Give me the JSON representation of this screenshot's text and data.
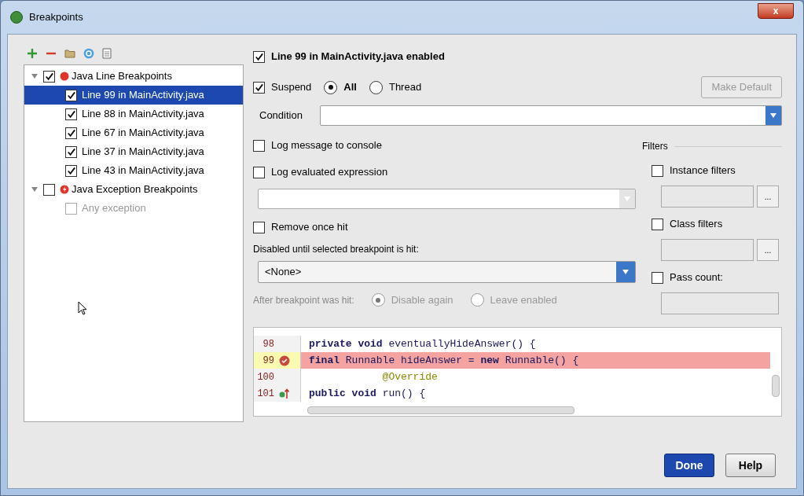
{
  "window": {
    "title": "Breakpoints",
    "close": "x"
  },
  "toolbar": [
    {
      "kind": "add"
    },
    {
      "kind": "remove"
    },
    {
      "kind": "folder"
    },
    {
      "kind": "class"
    },
    {
      "kind": "file"
    }
  ],
  "tree": [
    {
      "label": "Java Line Breakpoints",
      "kind": "line",
      "checked": true,
      "expanded": true,
      "selected": false,
      "children": [
        {
          "label": "Line 99 in MainActivity.java",
          "checked": true,
          "selected": true,
          "disabled": false
        },
        {
          "label": "Line 88 in MainActivity.java",
          "checked": true,
          "selected": false,
          "disabled": false
        },
        {
          "label": "Line 67 in MainActivity.java",
          "checked": true,
          "selected": false,
          "disabled": false
        },
        {
          "label": "Line 37 in MainActivity.java",
          "checked": true,
          "selected": false,
          "disabled": false
        },
        {
          "label": "Line 43 in MainActivity.java",
          "checked": true,
          "selected": false,
          "disabled": false
        }
      ]
    },
    {
      "label": "Java Exception Breakpoints",
      "kind": "exception",
      "checked": false,
      "expanded": true,
      "selected": false,
      "children": [
        {
          "label": "Any exception",
          "checked": false,
          "selected": false,
          "disabled": true
        }
      ]
    }
  ],
  "details": {
    "enabled": {
      "label": "Line 99 in MainActivity.java enabled",
      "checked": true
    },
    "suspend": {
      "label": "Suspend",
      "checked": true
    },
    "suspend_options": [
      {
        "label": "All",
        "selected": true
      },
      {
        "label": "Thread",
        "selected": false
      }
    ],
    "make_default": {
      "label": "Make Default",
      "disabled": true
    },
    "condition": {
      "label": "Condition"
    },
    "log_message": {
      "label": "Log message to console",
      "checked": false
    },
    "log_expression": {
      "label": "Log evaluated expression",
      "checked": false
    },
    "remove_once_hit": {
      "label": "Remove once hit",
      "checked": false
    },
    "disabled_until": {
      "label": "Disabled until selected breakpoint is hit:",
      "value": "<None>"
    },
    "after_hit": {
      "label": "After breakpoint was hit:",
      "options": [
        {
          "label": "Disable again",
          "selected": true
        },
        {
          "label": "Leave enabled",
          "selected": false
        }
      ]
    },
    "filters": {
      "title": "Filters",
      "items": [
        {
          "label": "Instance filters",
          "checked": false,
          "browse": "..."
        },
        {
          "label": "Class filters",
          "checked": false,
          "browse": "..."
        },
        {
          "label": "Pass count:",
          "checked": false
        }
      ]
    }
  },
  "code": [
    {
      "number": "98",
      "text": "    **private void** eventuallyHideAnswer() {",
      "kind": "plain",
      "highlighted": false,
      "breakpoint": false,
      "override": false
    },
    {
      "number": "99",
      "text": "        **final** Runnable hideAnswer = **new** Runnable() {",
      "kind": "plain",
      "highlighted": true,
      "breakpoint": true,
      "override": false
    },
    {
      "number": "100",
      "text": "            @Override",
      "kind": "annotation",
      "highlighted": false,
      "breakpoint": false,
      "override": false
    },
    {
      "number": "101",
      "text": "            **public void** run() {",
      "kind": "plain",
      "highlighted": false,
      "breakpoint": false,
      "override": true
    }
  ],
  "buttons": [
    {
      "label": "Done",
      "primary": true
    },
    {
      "label": "Help",
      "primary": false
    }
  ]
}
